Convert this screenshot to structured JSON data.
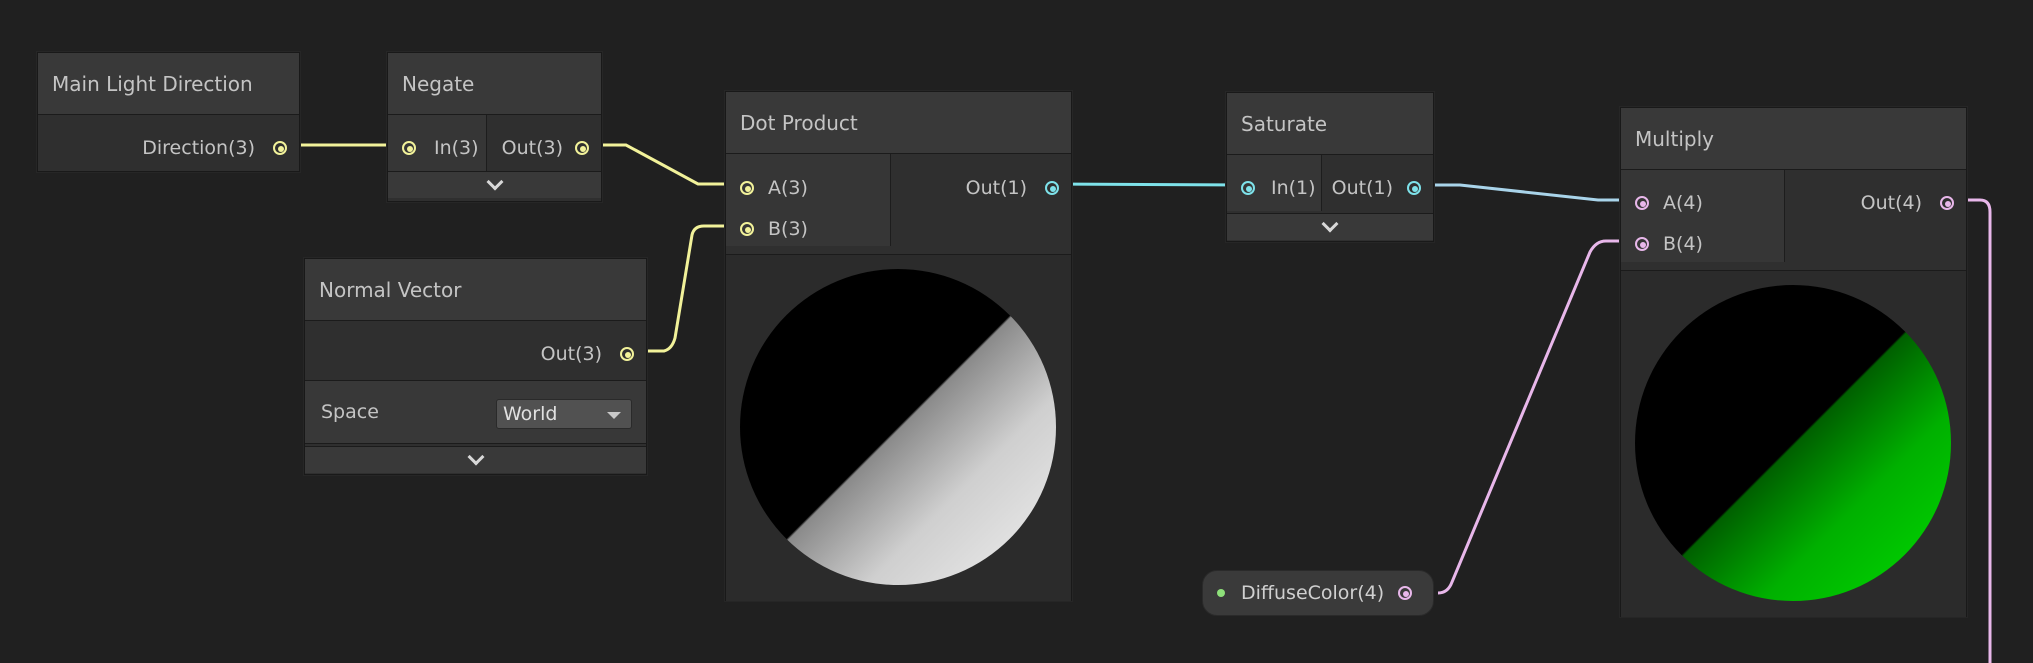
{
  "colors": {
    "background": "#202020",
    "vector3_wire": "#f2f29a",
    "vector1_wire": "#7ee2ea",
    "vector4_wire": "#e8b7ea",
    "property_dot": "#8ee07a"
  },
  "nodes": {
    "main_light_direction": {
      "title": "Main Light Direction",
      "outputs": [
        "Direction(3)"
      ]
    },
    "negate": {
      "title": "Negate",
      "inputs": [
        "In(3)"
      ],
      "outputs": [
        "Out(3)"
      ]
    },
    "normal_vector": {
      "title": "Normal Vector",
      "outputs": [
        "Out(3)"
      ],
      "space_label": "Space",
      "space_value": "World"
    },
    "dot_product": {
      "title": "Dot Product",
      "inputs": [
        "A(3)",
        "B(3)"
      ],
      "outputs": [
        "Out(1)"
      ]
    },
    "saturate": {
      "title": "Saturate",
      "inputs": [
        "In(1)"
      ],
      "outputs": [
        "Out(1)"
      ]
    },
    "multiply": {
      "title": "Multiply",
      "inputs": [
        "A(4)",
        "B(4)"
      ],
      "outputs": [
        "Out(4)"
      ]
    },
    "diffuse_color": {
      "label": "DiffuseColor(4)"
    }
  },
  "icons": {
    "collapse": "chevron-down-icon",
    "port": "port-circle-icon",
    "dropdown": "dropdown-arrow-icon"
  }
}
